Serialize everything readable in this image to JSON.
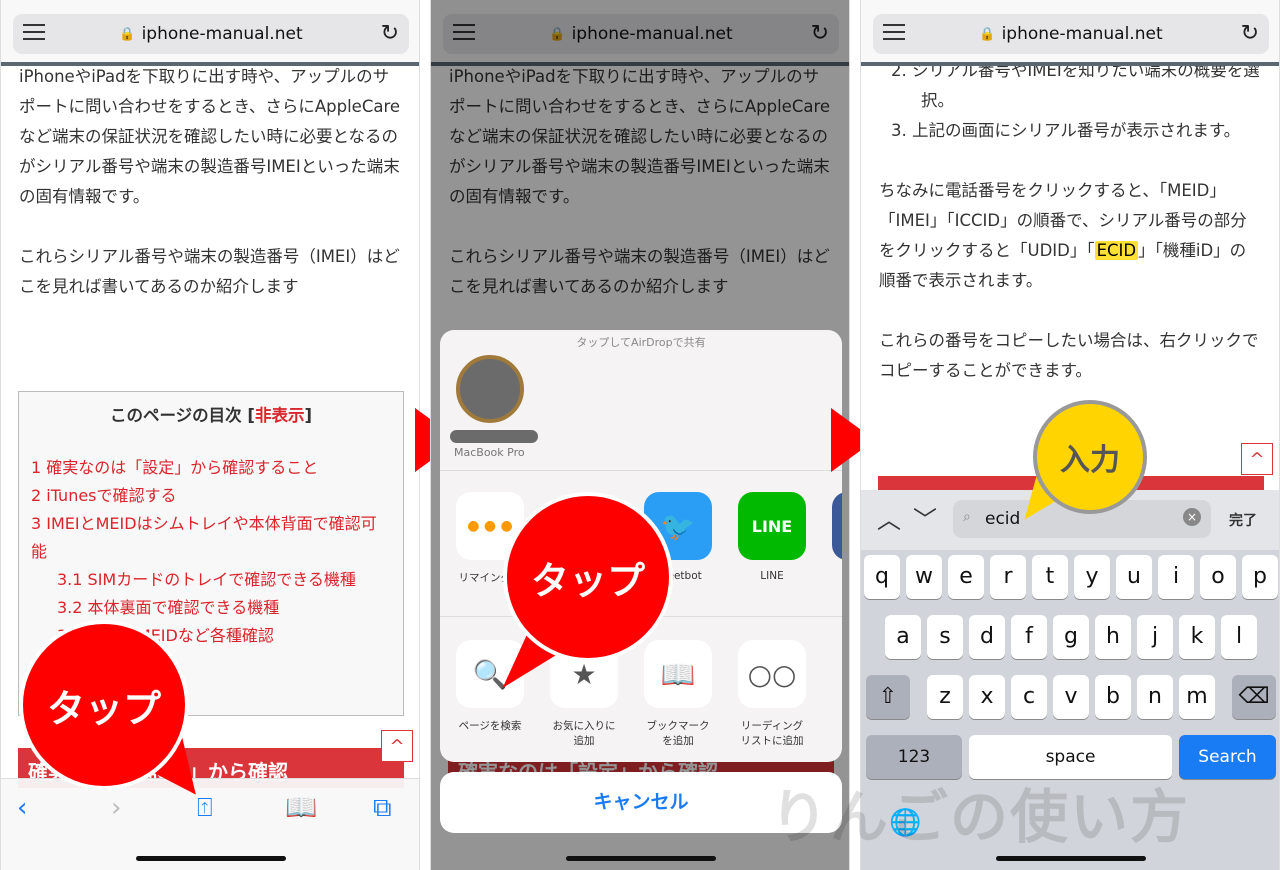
{
  "url": "iphone-manual.net",
  "panel1": {
    "paragraphs": [
      "iPhoneやiPadを下取りに出す時や、アップルのサポートに問い合わせをするとき、さらにAppleCareなど端末の保証状況を確認したい時に必要となるのがシリアル番号や端末の製造番号IMEIといった端末の固有情報です。",
      "これらシリアル番号や端末の製造番号（IMEI）はどこを見れば書いてあるのか紹介します"
    ],
    "toc_title": "このページの目次",
    "toc_toggle": "非表示",
    "toc_items": [
      "1 確実なのは「設定」から確認すること",
      "2 iTunesで確認する",
      "3 IMEIとMEIDはシムトレイや本体背面で確認可能",
      "3.1 SIMカードのトレイで確認できる機種",
      "3.2 本体裏面で確認できる機種",
      "3.3 IMEI、MEIDなど各種確認"
    ],
    "heading": "確実なのは「設定」から確認",
    "bubble": "タップ"
  },
  "panel2": {
    "airdrop_label": "タップしてAirDropで共有",
    "device": "MacBook Pro",
    "apps": [
      {
        "label": "リマインダー"
      },
      {
        "label": "Tweetbot"
      },
      {
        "label": "LINE",
        "icon_text": "LINE"
      }
    ],
    "actions": [
      {
        "label": "ページを検索",
        "icon": "search-icon"
      },
      {
        "label": "お気に入りに追加",
        "icon": "star-icon"
      },
      {
        "label": "ブックマークを追加",
        "icon": "book-icon"
      },
      {
        "label": "リーディングリストに追加",
        "icon": "glasses-icon"
      }
    ],
    "cancel": "キャンセル",
    "bubble": "タップ"
  },
  "panel3": {
    "list": [
      "2. シリアル番号やIMEIを知りたい端末の概要を選択。",
      "3. 上記の画面にシリアル番号が表示されます。"
    ],
    "p1a": "ちなみに電話番号をクリックすると、「MEID」「IMEI」「ICCID」の順番で、シリアル番号の部分をクリックすると「UDID」「",
    "p1hl": "ECID",
    "p1b": "」「機種iD」の順番で表示されます。",
    "p2": "これらの番号をコピーしたい場合は、右クリックでコピーすることができます。",
    "search_value": "ecid",
    "done": "完了",
    "rows": [
      [
        "q",
        "w",
        "e",
        "r",
        "t",
        "y",
        "u",
        "i",
        "o",
        "p"
      ],
      [
        "a",
        "s",
        "d",
        "f",
        "g",
        "h",
        "j",
        "k",
        "l"
      ],
      [
        "z",
        "x",
        "c",
        "v",
        "b",
        "n",
        "m"
      ]
    ],
    "num_key": "123",
    "space_key": "space",
    "search_key": "Search",
    "bubble": "入力"
  },
  "watermark": "りんごの使い方",
  "colors": {
    "accent_red": "#d9252b",
    "ios_blue": "#1a7cf5",
    "bubble_red": "#ff0000",
    "bubble_yellow": "#ffd400",
    "highlight": "#ffe033"
  }
}
